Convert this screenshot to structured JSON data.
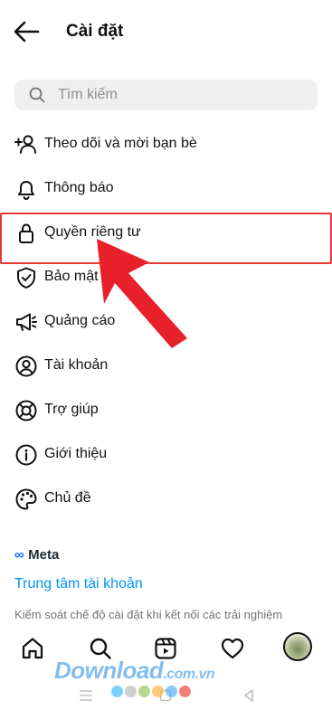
{
  "header": {
    "title": "Cài đặt",
    "back_icon": "arrow-left-icon"
  },
  "search": {
    "placeholder": "Tìm kiếm",
    "icon": "search-icon"
  },
  "menu": [
    {
      "label": "Theo dõi và mời bạn bè",
      "icon": "add-person-icon"
    },
    {
      "label": "Thông báo",
      "icon": "bell-icon"
    },
    {
      "label": "Quyền riêng tư",
      "icon": "lock-icon"
    },
    {
      "label": "Bảo mật",
      "icon": "shield-check-icon"
    },
    {
      "label": "Quảng cáo",
      "icon": "megaphone-icon"
    },
    {
      "label": "Tài khoản",
      "icon": "account-circle-icon"
    },
    {
      "label": "Trợ giúp",
      "icon": "lifebuoy-icon"
    },
    {
      "label": "Giới thiệu",
      "icon": "info-icon"
    },
    {
      "label": "Chủ đề",
      "icon": "palette-icon"
    }
  ],
  "meta": {
    "logo_symbol": "∞",
    "logo_text": "Meta",
    "accounts_center_link": "Trung tâm tài khoản",
    "description": "Kiểm soát chế độ cài đặt khi kết nối các trải nghiệm"
  },
  "tabbar": [
    "home-icon",
    "search-icon",
    "reels-icon",
    "heart-icon",
    "profile-avatar"
  ],
  "watermark": {
    "text": "Download",
    "suffix": ".com.vn"
  },
  "colors": {
    "accent_link": "#0095f6",
    "highlight": "#e53935",
    "arrow": "#e8202a",
    "search_bg": "#efefef",
    "meta_blue": "#0866ff",
    "dots": [
      "#4fc3f7",
      "#bdbdbd",
      "#9ccc65",
      "#ffb74d",
      "#64b5f6",
      "#ef5350"
    ]
  }
}
